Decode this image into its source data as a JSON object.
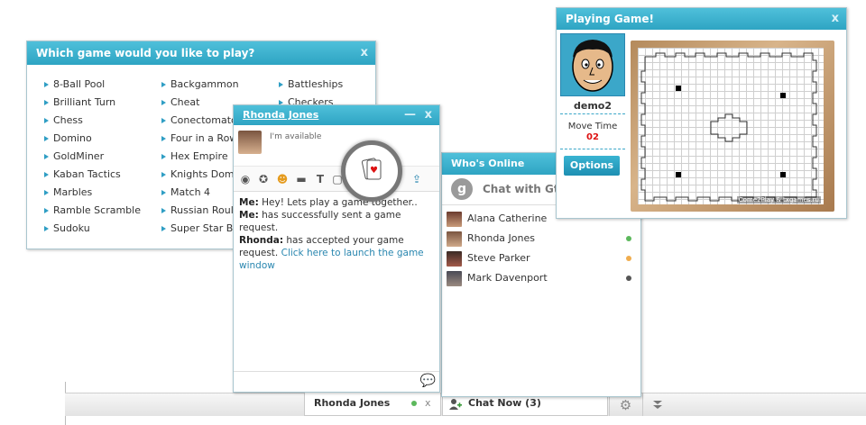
{
  "games_panel": {
    "title": "Which game would you like to play?",
    "close": "x",
    "col1": [
      "8-Ball Pool",
      "Brilliant Turn",
      "Chess",
      "Domino",
      "GoldMiner",
      "Kaban Tactics",
      "Marbles",
      "Ramble Scramble",
      "Sudoku"
    ],
    "col2": [
      "Backgammon",
      "Cheat",
      "Conectomato",
      "Four in a Row",
      "Hex Empire",
      "Knights Dom",
      "Match 4",
      "Russian Roul",
      "Super Star Ba"
    ],
    "col3": [
      "Battleships",
      "Checkers"
    ]
  },
  "chat_window": {
    "contact_name": "Rhonda Jones",
    "minimize": "—",
    "close": "x",
    "status": "I'm available",
    "messages": [
      {
        "sender": "Me:",
        "text": "Hey! Lets play a game together.."
      },
      {
        "sender": "Me:",
        "text": "has successfully sent a game request."
      },
      {
        "sender": "Rhonda:",
        "text": "has accepted your game request.",
        "link": "Click here to launch the game window"
      }
    ]
  },
  "online_panel": {
    "title": "Who's Online",
    "gtalk_label": "Chat with Gtalk",
    "contacts": [
      {
        "name": "Alana Catherine",
        "status_color": ""
      },
      {
        "name": "Rhonda Jones",
        "status_color": "#5cb85c"
      },
      {
        "name": "Steve Parker",
        "status_color": "#f0ad4e"
      },
      {
        "name": "Mark Davenport",
        "status_color": "#555555"
      }
    ]
  },
  "playing_panel": {
    "title": "Playing Game!",
    "close": "x",
    "player_name": "demo2",
    "move_time_label": "Move Time",
    "move_time_value": "02",
    "options_label": "Options",
    "credit": "Come2Play & txgames.ru"
  },
  "bottom_bar": {
    "chat_tab_name": "Rhonda Jones",
    "chat_tab_close": "x",
    "chat_now_label": "Chat Now (3)"
  },
  "colors": {
    "title_bar": "#2ea4c3",
    "accent_link": "#2a87b0",
    "online": "#5cb85c",
    "away": "#f0ad4e",
    "offline": "#555555"
  }
}
